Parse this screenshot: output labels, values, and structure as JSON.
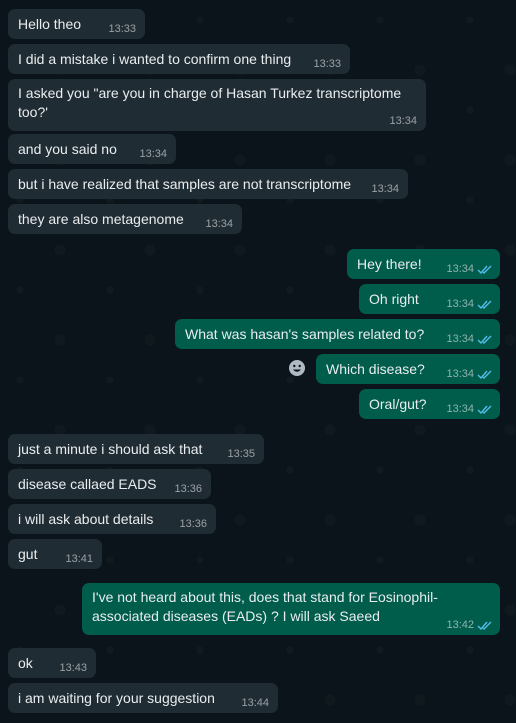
{
  "messages": [
    {
      "text": "Hello theo",
      "time": "13:33"
    },
    {
      "text": "I did a mistake i wanted to confirm one thing",
      "time": "13:33"
    },
    {
      "text_line1": "I asked you \"are you in charge of Hasan Turkez transcriptome",
      "text_line2": "too?'",
      "time": "13:34"
    },
    {
      "text": "and you said no",
      "time": "13:34"
    },
    {
      "text": "but i have realized that samples are not transcriptome",
      "time": "13:34"
    },
    {
      "text": "they are also metagenome",
      "time": "13:34"
    },
    {
      "text": "Hey there!",
      "time": "13:34"
    },
    {
      "text": "Oh right",
      "time": "13:34"
    },
    {
      "text": "What was hasan's samples related to?",
      "time": "13:34"
    },
    {
      "text": "Which disease?",
      "time": "13:34"
    },
    {
      "text": "Oral/gut?",
      "time": "13:34"
    },
    {
      "text": "just a minute i should ask that",
      "time": "13:35"
    },
    {
      "text": "disease callaed EADS",
      "time": "13:36"
    },
    {
      "text": "i will ask about details",
      "time": "13:36"
    },
    {
      "text": "gut",
      "time": "13:41"
    },
    {
      "text_line1": "I've not heard about this, does that stand for Eosinophil-",
      "text_line2": "associated diseases (EADs) ? I will ask Saeed",
      "time": "13:42"
    },
    {
      "text": "ok",
      "time": "13:43"
    },
    {
      "text": "i am waiting for your suggestion",
      "time": "13:44"
    }
  ],
  "colors": {
    "incoming": "#202c33",
    "outgoing": "#005c4b",
    "background": "#0b141a",
    "read_ticks": "#53bdeb"
  },
  "icons": {
    "read_receipt": "double-check-icon",
    "reaction": "emoji-icon"
  }
}
